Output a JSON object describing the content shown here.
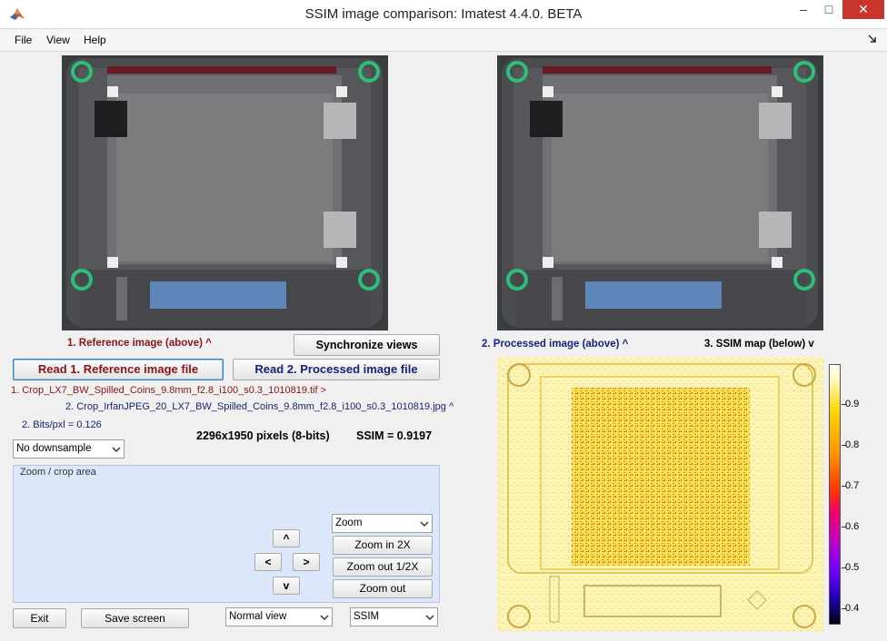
{
  "window": {
    "title": "SSIM image comparison:  Imatest 4.4.0. BETA",
    "minimize": "–",
    "maximize": "□",
    "close": "✕"
  },
  "menu": {
    "file": "File",
    "view": "View",
    "help": "Help"
  },
  "labels": {
    "reference": "1.  Reference image (above)   ^",
    "processed": "2.  Processed image (above)   ^",
    "ssim_map": "3.  SSIM map (below)   v",
    "pixels": "2296x1950 pixels  (8-bits)",
    "ssim_value": "SSIM = 0.9197",
    "bits_per_pixel": "2. Bits/pxl = 0.126",
    "zoom_panel_title": "Zoom / crop area"
  },
  "files": {
    "reference_file": "1. Crop_LX7_BW_Spilled_Coins_9.8mm_f2.8_i100_s0.3_1010819.tif >",
    "processed_file": "2. Crop_IrfanJPEG_20_LX7_BW_Spilled_Coins_9.8mm_f2.8_i100_s0.3_1010819.jpg ^"
  },
  "buttons": {
    "synchronize": "Synchronize views",
    "read_reference": "Read 1. Reference image file",
    "read_processed": "Read 2. Processed image file",
    "up": "^",
    "left": "<",
    "right": ">",
    "down": "v",
    "zoom_in": "Zoom in  2X",
    "zoom_out_half": "Zoom out 1/2X",
    "zoom_out": "Zoom out",
    "exit": "Exit",
    "save_screen": "Save screen"
  },
  "selects": {
    "downsample": "No downsample",
    "zoom_mode": "Zoom",
    "view_mode": "Normal view",
    "display": "SSIM"
  },
  "colorbar": {
    "ticks": [
      "0.9",
      "0.8",
      "0.7",
      "0.6",
      "0.5",
      "0.4"
    ]
  },
  "colors": {
    "reference_red": "#8b1418",
    "processed_blue": "#17237a",
    "zoom_panel_bg": "#dde7fb",
    "close_button": "#c7352c"
  },
  "icons": {
    "app": "matlab-logo-icon",
    "dock": "dock-arrow-icon",
    "dropdown": "chevron-down-icon"
  }
}
